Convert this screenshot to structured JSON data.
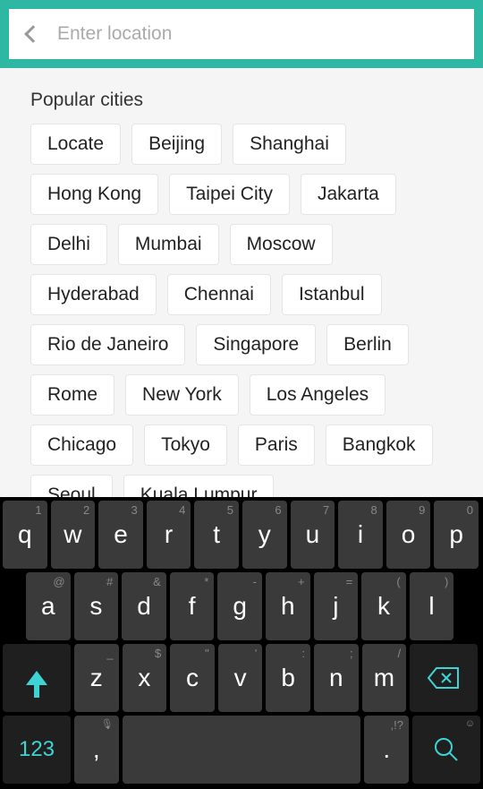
{
  "header": {
    "search_placeholder": "Enter location"
  },
  "section": {
    "title": "Popular cities"
  },
  "cities": [
    "Locate",
    "Beijing",
    "Shanghai",
    "Hong Kong",
    "Taipei City",
    "Jakarta",
    "Delhi",
    "Mumbai",
    "Moscow",
    "Hyderabad",
    "Chennai",
    "Istanbul",
    "Rio de Janeiro",
    "Singapore",
    "Berlin",
    "Rome",
    "New York",
    "Los Angeles",
    "Chicago",
    "Tokyo",
    "Paris",
    "Bangkok",
    "Seoul",
    "Kuala Lumpur"
  ],
  "keyboard": {
    "row1": [
      {
        "main": "q",
        "num": "1"
      },
      {
        "main": "w",
        "num": "2"
      },
      {
        "main": "e",
        "num": "3"
      },
      {
        "main": "r",
        "num": "4"
      },
      {
        "main": "t",
        "num": "5"
      },
      {
        "main": "y",
        "num": "6"
      },
      {
        "main": "u",
        "num": "7"
      },
      {
        "main": "i",
        "num": "8"
      },
      {
        "main": "o",
        "num": "9"
      },
      {
        "main": "p",
        "num": "0"
      }
    ],
    "row2": [
      {
        "main": "a",
        "sym": "@"
      },
      {
        "main": "s",
        "sym": "#"
      },
      {
        "main": "d",
        "sym": "&"
      },
      {
        "main": "f",
        "sym": "*"
      },
      {
        "main": "g",
        "sym": "-"
      },
      {
        "main": "h",
        "sym": "+"
      },
      {
        "main": "j",
        "sym": "="
      },
      {
        "main": "k",
        "sym": "("
      },
      {
        "main": "l",
        "sym": ")"
      }
    ],
    "row3": [
      {
        "main": "z",
        "sym": "_"
      },
      {
        "main": "x",
        "sym": "$"
      },
      {
        "main": "c",
        "sym": "\""
      },
      {
        "main": "v",
        "sym": "'"
      },
      {
        "main": "b",
        "sym": ":"
      },
      {
        "main": "n",
        "sym": ";"
      },
      {
        "main": "m",
        "sym": "/"
      }
    ],
    "nums_label": "123",
    "comma": ",",
    "dot": ".",
    "comma_sym": "🎤",
    "dot_sym": ",!?",
    "search_sym": "☺"
  }
}
